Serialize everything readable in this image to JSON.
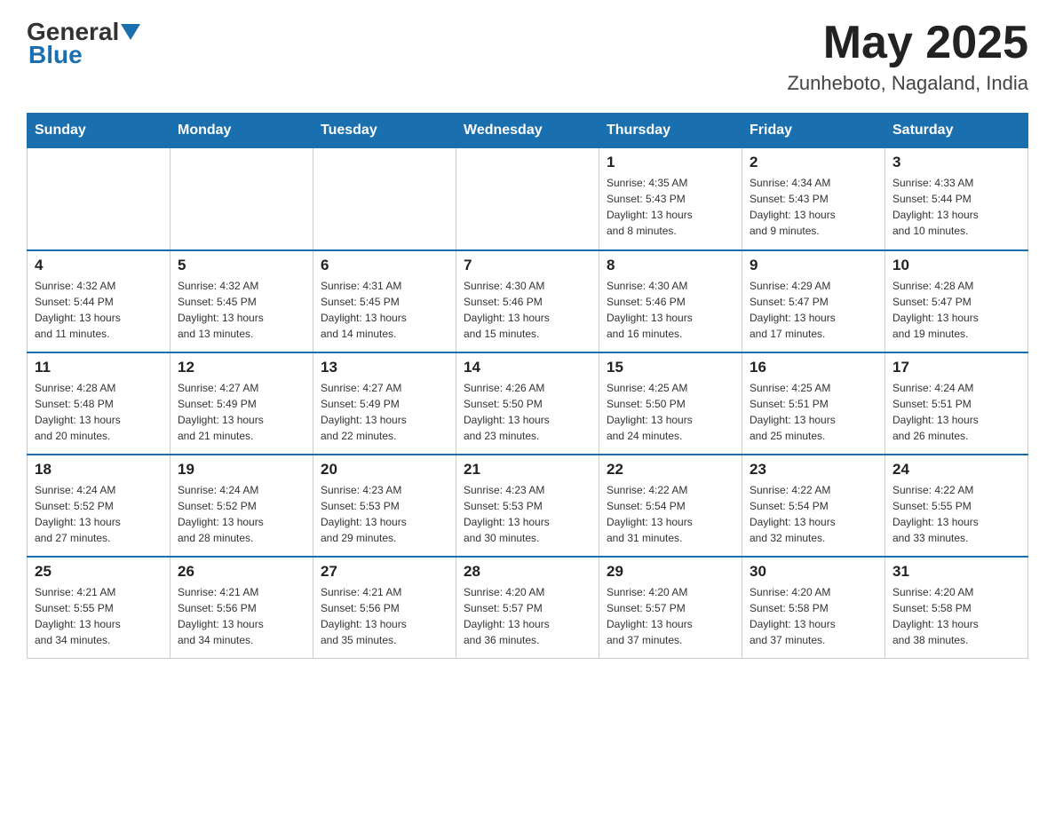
{
  "header": {
    "logo_general": "General",
    "logo_blue": "Blue",
    "month_year": "May 2025",
    "location": "Zunheboto, Nagaland, India"
  },
  "days_of_week": [
    "Sunday",
    "Monday",
    "Tuesday",
    "Wednesday",
    "Thursday",
    "Friday",
    "Saturday"
  ],
  "weeks": [
    [
      {
        "day": "",
        "info": ""
      },
      {
        "day": "",
        "info": ""
      },
      {
        "day": "",
        "info": ""
      },
      {
        "day": "",
        "info": ""
      },
      {
        "day": "1",
        "info": "Sunrise: 4:35 AM\nSunset: 5:43 PM\nDaylight: 13 hours\nand 8 minutes."
      },
      {
        "day": "2",
        "info": "Sunrise: 4:34 AM\nSunset: 5:43 PM\nDaylight: 13 hours\nand 9 minutes."
      },
      {
        "day": "3",
        "info": "Sunrise: 4:33 AM\nSunset: 5:44 PM\nDaylight: 13 hours\nand 10 minutes."
      }
    ],
    [
      {
        "day": "4",
        "info": "Sunrise: 4:32 AM\nSunset: 5:44 PM\nDaylight: 13 hours\nand 11 minutes."
      },
      {
        "day": "5",
        "info": "Sunrise: 4:32 AM\nSunset: 5:45 PM\nDaylight: 13 hours\nand 13 minutes."
      },
      {
        "day": "6",
        "info": "Sunrise: 4:31 AM\nSunset: 5:45 PM\nDaylight: 13 hours\nand 14 minutes."
      },
      {
        "day": "7",
        "info": "Sunrise: 4:30 AM\nSunset: 5:46 PM\nDaylight: 13 hours\nand 15 minutes."
      },
      {
        "day": "8",
        "info": "Sunrise: 4:30 AM\nSunset: 5:46 PM\nDaylight: 13 hours\nand 16 minutes."
      },
      {
        "day": "9",
        "info": "Sunrise: 4:29 AM\nSunset: 5:47 PM\nDaylight: 13 hours\nand 17 minutes."
      },
      {
        "day": "10",
        "info": "Sunrise: 4:28 AM\nSunset: 5:47 PM\nDaylight: 13 hours\nand 19 minutes."
      }
    ],
    [
      {
        "day": "11",
        "info": "Sunrise: 4:28 AM\nSunset: 5:48 PM\nDaylight: 13 hours\nand 20 minutes."
      },
      {
        "day": "12",
        "info": "Sunrise: 4:27 AM\nSunset: 5:49 PM\nDaylight: 13 hours\nand 21 minutes."
      },
      {
        "day": "13",
        "info": "Sunrise: 4:27 AM\nSunset: 5:49 PM\nDaylight: 13 hours\nand 22 minutes."
      },
      {
        "day": "14",
        "info": "Sunrise: 4:26 AM\nSunset: 5:50 PM\nDaylight: 13 hours\nand 23 minutes."
      },
      {
        "day": "15",
        "info": "Sunrise: 4:25 AM\nSunset: 5:50 PM\nDaylight: 13 hours\nand 24 minutes."
      },
      {
        "day": "16",
        "info": "Sunrise: 4:25 AM\nSunset: 5:51 PM\nDaylight: 13 hours\nand 25 minutes."
      },
      {
        "day": "17",
        "info": "Sunrise: 4:24 AM\nSunset: 5:51 PM\nDaylight: 13 hours\nand 26 minutes."
      }
    ],
    [
      {
        "day": "18",
        "info": "Sunrise: 4:24 AM\nSunset: 5:52 PM\nDaylight: 13 hours\nand 27 minutes."
      },
      {
        "day": "19",
        "info": "Sunrise: 4:24 AM\nSunset: 5:52 PM\nDaylight: 13 hours\nand 28 minutes."
      },
      {
        "day": "20",
        "info": "Sunrise: 4:23 AM\nSunset: 5:53 PM\nDaylight: 13 hours\nand 29 minutes."
      },
      {
        "day": "21",
        "info": "Sunrise: 4:23 AM\nSunset: 5:53 PM\nDaylight: 13 hours\nand 30 minutes."
      },
      {
        "day": "22",
        "info": "Sunrise: 4:22 AM\nSunset: 5:54 PM\nDaylight: 13 hours\nand 31 minutes."
      },
      {
        "day": "23",
        "info": "Sunrise: 4:22 AM\nSunset: 5:54 PM\nDaylight: 13 hours\nand 32 minutes."
      },
      {
        "day": "24",
        "info": "Sunrise: 4:22 AM\nSunset: 5:55 PM\nDaylight: 13 hours\nand 33 minutes."
      }
    ],
    [
      {
        "day": "25",
        "info": "Sunrise: 4:21 AM\nSunset: 5:55 PM\nDaylight: 13 hours\nand 34 minutes."
      },
      {
        "day": "26",
        "info": "Sunrise: 4:21 AM\nSunset: 5:56 PM\nDaylight: 13 hours\nand 34 minutes."
      },
      {
        "day": "27",
        "info": "Sunrise: 4:21 AM\nSunset: 5:56 PM\nDaylight: 13 hours\nand 35 minutes."
      },
      {
        "day": "28",
        "info": "Sunrise: 4:20 AM\nSunset: 5:57 PM\nDaylight: 13 hours\nand 36 minutes."
      },
      {
        "day": "29",
        "info": "Sunrise: 4:20 AM\nSunset: 5:57 PM\nDaylight: 13 hours\nand 37 minutes."
      },
      {
        "day": "30",
        "info": "Sunrise: 4:20 AM\nSunset: 5:58 PM\nDaylight: 13 hours\nand 37 minutes."
      },
      {
        "day": "31",
        "info": "Sunrise: 4:20 AM\nSunset: 5:58 PM\nDaylight: 13 hours\nand 38 minutes."
      }
    ]
  ]
}
